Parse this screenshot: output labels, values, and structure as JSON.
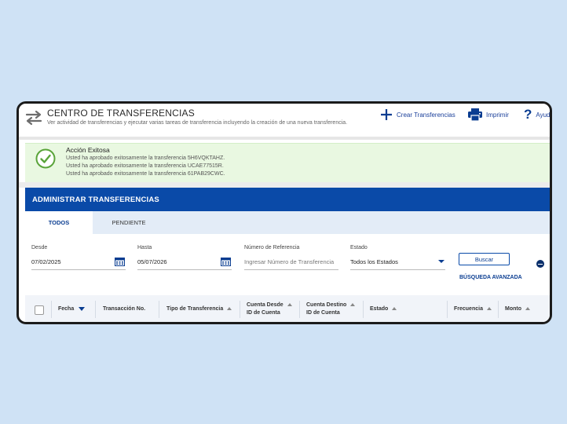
{
  "header": {
    "title": "CENTRO DE TRANSFERENCIAS",
    "subtitle": "Ver actividad de transferencias y ejecutar varias tareas de transferencia incluyendo la creación de una nueva transferencia.",
    "actions": [
      {
        "label": "Crear Transferencias",
        "icon": "plus-icon"
      },
      {
        "label": "Imprimir",
        "icon": "printer-icon"
      },
      {
        "label": "Ayuda",
        "icon": "question-icon"
      }
    ]
  },
  "success": {
    "title": "Acción Exitosa",
    "messages": [
      "Usted ha aprobado exitosamente la transferencia 5H6VQKTAHZ.",
      "Usted ha aprobado exitosamente la transferencia UCAE77515R.",
      "Usted ha aprobado exitosamente la transferencia 61PAB29CWC."
    ],
    "icon": "check-circle-icon"
  },
  "admin": {
    "title": "ADMINISTRAR TRANSFERENCIAS"
  },
  "tabs": [
    {
      "label": "TODOS",
      "active": true
    },
    {
      "label": "PENDIENTE",
      "active": false
    }
  ],
  "filters": {
    "desde": {
      "label": "Desde",
      "value": "07/02/2025"
    },
    "hasta": {
      "label": "Hasta",
      "value": "05/07/2026"
    },
    "referencia": {
      "label": "Número de Referencia",
      "placeholder": "Ingresar Número de Transferencia"
    },
    "estado": {
      "label": "Estado",
      "value": "Todos los Estados"
    },
    "buscar": "Buscar",
    "advanced": "BÚSQUEDA AVANZADA"
  },
  "table": {
    "columns": [
      {
        "line1": "Fecha",
        "line2": "",
        "sort": "desc"
      },
      {
        "line1": "Transacción No.",
        "line2": "",
        "sort": "none"
      },
      {
        "line1": "Tipo de Transferencia",
        "line2": "",
        "sort": "asc"
      },
      {
        "line1": "Cuenta Desde",
        "line2": "ID de Cuenta",
        "sort": "asc"
      },
      {
        "line1": "Cuenta Destino",
        "line2": "ID de Cuenta",
        "sort": "asc"
      },
      {
        "line1": "Estado",
        "line2": "",
        "sort": "asc"
      },
      {
        "line1": "Frecuencia",
        "line2": "",
        "sort": "asc"
      },
      {
        "line1": "Monto",
        "line2": "",
        "sort": "asc"
      }
    ]
  },
  "colors": {
    "primary": "#0a4aa8",
    "success_bg": "#e9f8e1",
    "success_icon": "#5aa43a",
    "page_bg": "#cfe2f5"
  }
}
